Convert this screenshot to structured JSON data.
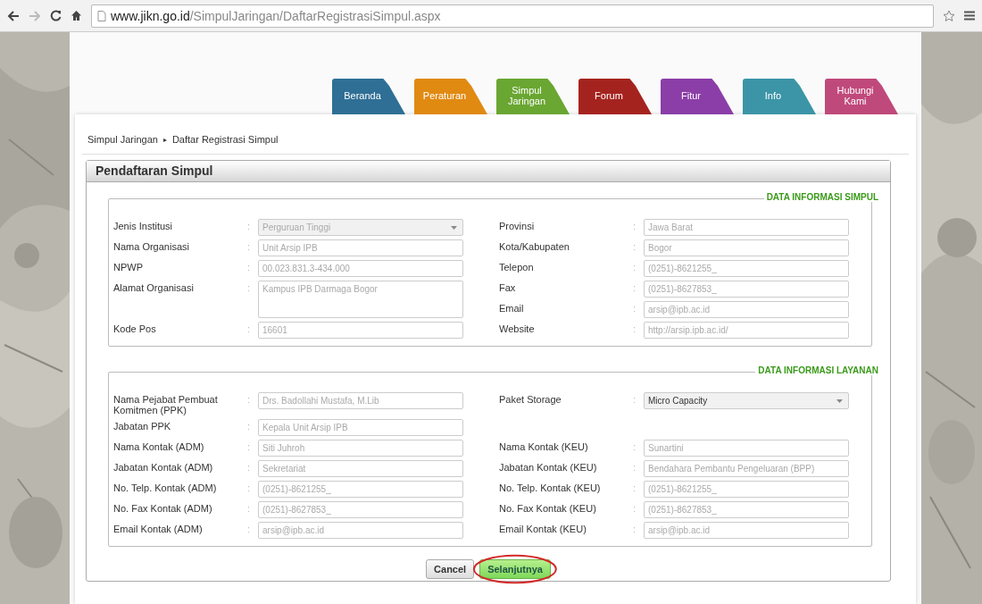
{
  "browser": {
    "url_host": "www.jikn.go.id",
    "url_path": "/SimpulJaringan/DaftarRegistrasiSimpul.aspx"
  },
  "tabs": [
    {
      "label": "Beranda",
      "color": "#2f6f95"
    },
    {
      "label": "Peraturan",
      "color": "#e08a12"
    },
    {
      "label": "Simpul Jaringan",
      "color": "#6aa632"
    },
    {
      "label": "Forum",
      "color": "#a5231f"
    },
    {
      "label": "Fitur",
      "color": "#8b3ea8"
    },
    {
      "label": "Info",
      "color": "#3b95a6"
    },
    {
      "label": "Hubungi Kami",
      "color": "#c0497b"
    }
  ],
  "breadcrumb": {
    "items": [
      "Simpul Jaringan",
      "Daftar Registrasi Simpul"
    ],
    "separator": "▸"
  },
  "panel": {
    "title": "Pendaftaran Simpul"
  },
  "sections": [
    {
      "legend": "DATA INFORMASI SIMPUL",
      "rows": [
        {
          "left": {
            "label": "Jenis Institusi",
            "colon": ":",
            "value": "Perguruan Tinggi",
            "kind": "select",
            "disabled": true
          },
          "right": {
            "label": "Provinsi",
            "colon": ":",
            "value": "Jawa Barat",
            "kind": "text",
            "disabled": true
          }
        },
        {
          "left": {
            "label": "Nama Organisasi",
            "colon": ":",
            "value": "Unit Arsip IPB",
            "kind": "text",
            "disabled": true
          },
          "right": {
            "label": "Kota/Kabupaten",
            "colon": ":",
            "value": "Bogor",
            "kind": "text",
            "disabled": true
          }
        },
        {
          "left": {
            "label": "NPWP",
            "colon": ":",
            "value": "00.023.831.3-434.000",
            "kind": "text",
            "disabled": true
          },
          "right": {
            "label": "Telepon",
            "colon": ":",
            "value": "(0251)-8621255_",
            "kind": "text",
            "disabled": true
          }
        },
        {
          "left": {
            "label": "Alamat Organisasi",
            "colon": ":",
            "value": "Kampus IPB Darmaga Bogor",
            "kind": "textarea",
            "disabled": true
          },
          "right": {
            "label": "Fax",
            "colon": ":",
            "value": "(0251)-8627853_",
            "kind": "text",
            "disabled": true
          }
        },
        {
          "right": {
            "label": "Email",
            "colon": ":",
            "value": "arsip@ipb.ac.id",
            "kind": "text",
            "disabled": true
          }
        },
        {
          "left": {
            "label": "Kode Pos",
            "colon": ":",
            "value": "16601",
            "kind": "text",
            "disabled": true
          },
          "right": {
            "label": "Website",
            "colon": ":",
            "value": "http://arsip.ipb.ac.id/",
            "kind": "text",
            "disabled": true
          }
        }
      ]
    },
    {
      "legend": "DATA INFORMASI LAYANAN",
      "rows": [
        {
          "left": {
            "label": "Nama Pejabat Pembuat Komitmen (PPK)",
            "colon": ":",
            "value": "Drs. Badollahi Mustafa, M.Lib",
            "kind": "text",
            "disabled": true
          },
          "right": {
            "label": "Paket Storage",
            "colon": ":",
            "value": "Micro Capacity",
            "kind": "select",
            "disabled": false
          }
        },
        {
          "left": {
            "label": "Jabatan PPK",
            "colon": ":",
            "value": "Kepala Unit Arsip IPB",
            "kind": "text",
            "disabled": true
          }
        },
        {
          "left": {
            "label": "Nama Kontak (ADM)",
            "colon": ":",
            "value": "Siti Juhroh",
            "kind": "text",
            "disabled": true
          },
          "right": {
            "label": "Nama Kontak (KEU)",
            "colon": ":",
            "value": "Sunartini",
            "kind": "text",
            "disabled": true
          }
        },
        {
          "left": {
            "label": "Jabatan Kontak (ADM)",
            "colon": ":",
            "value": "Sekretariat",
            "kind": "text",
            "disabled": true
          },
          "right": {
            "label": "Jabatan Kontak (KEU)",
            "colon": ":",
            "value": "Bendahara Pembantu Pengeluaran (BPP)",
            "kind": "text",
            "disabled": true
          }
        },
        {
          "left": {
            "label": "No. Telp. Kontak (ADM)",
            "colon": ":",
            "value": "(0251)-8621255_",
            "kind": "text",
            "disabled": true
          },
          "right": {
            "label": "No. Telp. Kontak (KEU)",
            "colon": ":",
            "value": "(0251)-8621255_",
            "kind": "text",
            "disabled": true
          }
        },
        {
          "left": {
            "label": "No. Fax Kontak (ADM)",
            "colon": ":",
            "value": "(0251)-8627853_",
            "kind": "text",
            "disabled": true
          },
          "right": {
            "label": "No. Fax Kontak (KEU)",
            "colon": ":",
            "value": "(0251)-8627853_",
            "kind": "text",
            "disabled": true
          }
        },
        {
          "left": {
            "label": "Email Kontak (ADM)",
            "colon": ":",
            "value": "arsip@ipb.ac.id",
            "kind": "text",
            "disabled": true
          },
          "right": {
            "label": "Email Kontak (KEU)",
            "colon": ":",
            "value": "arsip@ipb.ac.id",
            "kind": "text",
            "disabled": true
          }
        }
      ]
    }
  ],
  "buttons": [
    {
      "label": "Cancel",
      "kind": "secondary",
      "highlighted": false
    },
    {
      "label": "Selanjutnya",
      "kind": "primary",
      "highlighted": true
    }
  ]
}
